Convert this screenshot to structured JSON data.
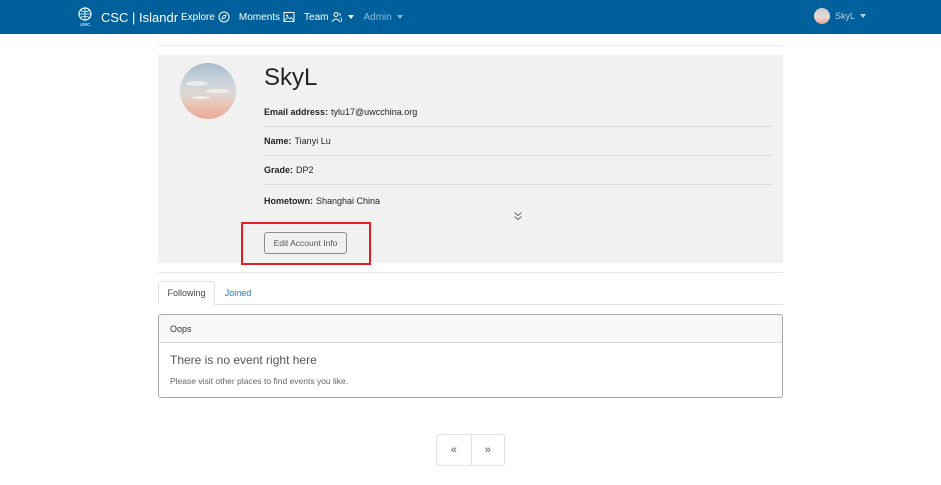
{
  "navbar": {
    "logo_text": "UWC",
    "brand": "CSC | Islandr",
    "items": [
      {
        "label": "Explore",
        "icon": "compass-icon"
      },
      {
        "label": "Moments",
        "icon": "image-icon"
      },
      {
        "label": "Team",
        "icon": "people-icon"
      },
      {
        "label": "Admin"
      }
    ],
    "user": {
      "name": "SkyL"
    },
    "color": "#00609c"
  },
  "profile": {
    "username": "SkyL",
    "fields": [
      {
        "label": "Email address:",
        "value": "tylu17@uwcchina.org"
      },
      {
        "label": "Name:",
        "value": "Tianyi Lu"
      },
      {
        "label": "Grade:",
        "value": "DP2"
      },
      {
        "label": "Hometown:",
        "value": "Shanghai China"
      }
    ],
    "expand_icon": "double-chevron-down-icon",
    "edit_button": "Edit Account Info"
  },
  "tabs": [
    {
      "label": "Following",
      "active": true
    },
    {
      "label": "Joined",
      "active": false
    }
  ],
  "events": {
    "header": "Oops",
    "title": "There is no event right here",
    "text": "Please visit other places to find events you like."
  },
  "pagination": {
    "prev": "«",
    "next": "»"
  },
  "highlight_color": "#e31e24"
}
